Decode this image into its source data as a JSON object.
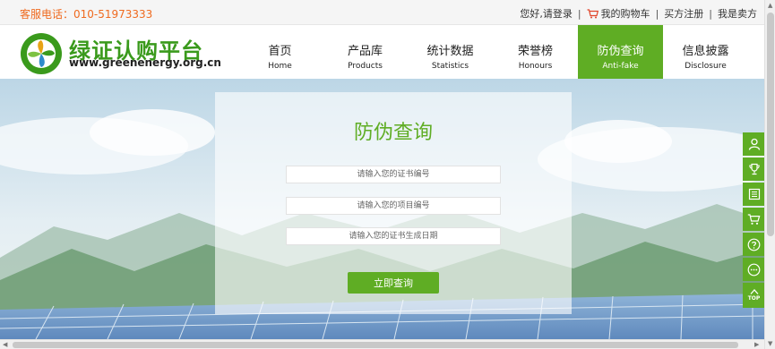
{
  "topbar": {
    "hotline_label": "客服电话：010-51973333",
    "greeting": "您好,请登录",
    "cart": "我的购物车",
    "buyer_register": "买方注册",
    "seller": "我是卖方",
    "separator": "|"
  },
  "logo": {
    "title": "绿证认购平台",
    "url": "www.greenenergy.org.cn"
  },
  "nav": {
    "items": [
      {
        "zh": "首页",
        "en": "Home"
      },
      {
        "zh": "产品库",
        "en": "Products"
      },
      {
        "zh": "统计数据",
        "en": "Statistics"
      },
      {
        "zh": "荣誉榜",
        "en": "Honours"
      },
      {
        "zh": "防伪查询",
        "en": "Anti-fake"
      },
      {
        "zh": "信息披露",
        "en": "Disclosure"
      }
    ],
    "active_index": 4
  },
  "search": {
    "title": "防伪查询",
    "cert_placeholder": "请输入您的证书编号",
    "project_placeholder": "请输入您的项目编号",
    "date_placeholder": "请输入您的证书生成日期",
    "submit_label": "立即查询"
  },
  "sidebar": {
    "icons": [
      "user-icon",
      "trophy-icon",
      "list-icon",
      "cart-icon",
      "help-icon",
      "chat-icon",
      "back-to-top-icon"
    ],
    "top_label": "TOP"
  },
  "colors": {
    "brand_green": "#5fad24",
    "hotline_orange": "#ef6a1f"
  }
}
